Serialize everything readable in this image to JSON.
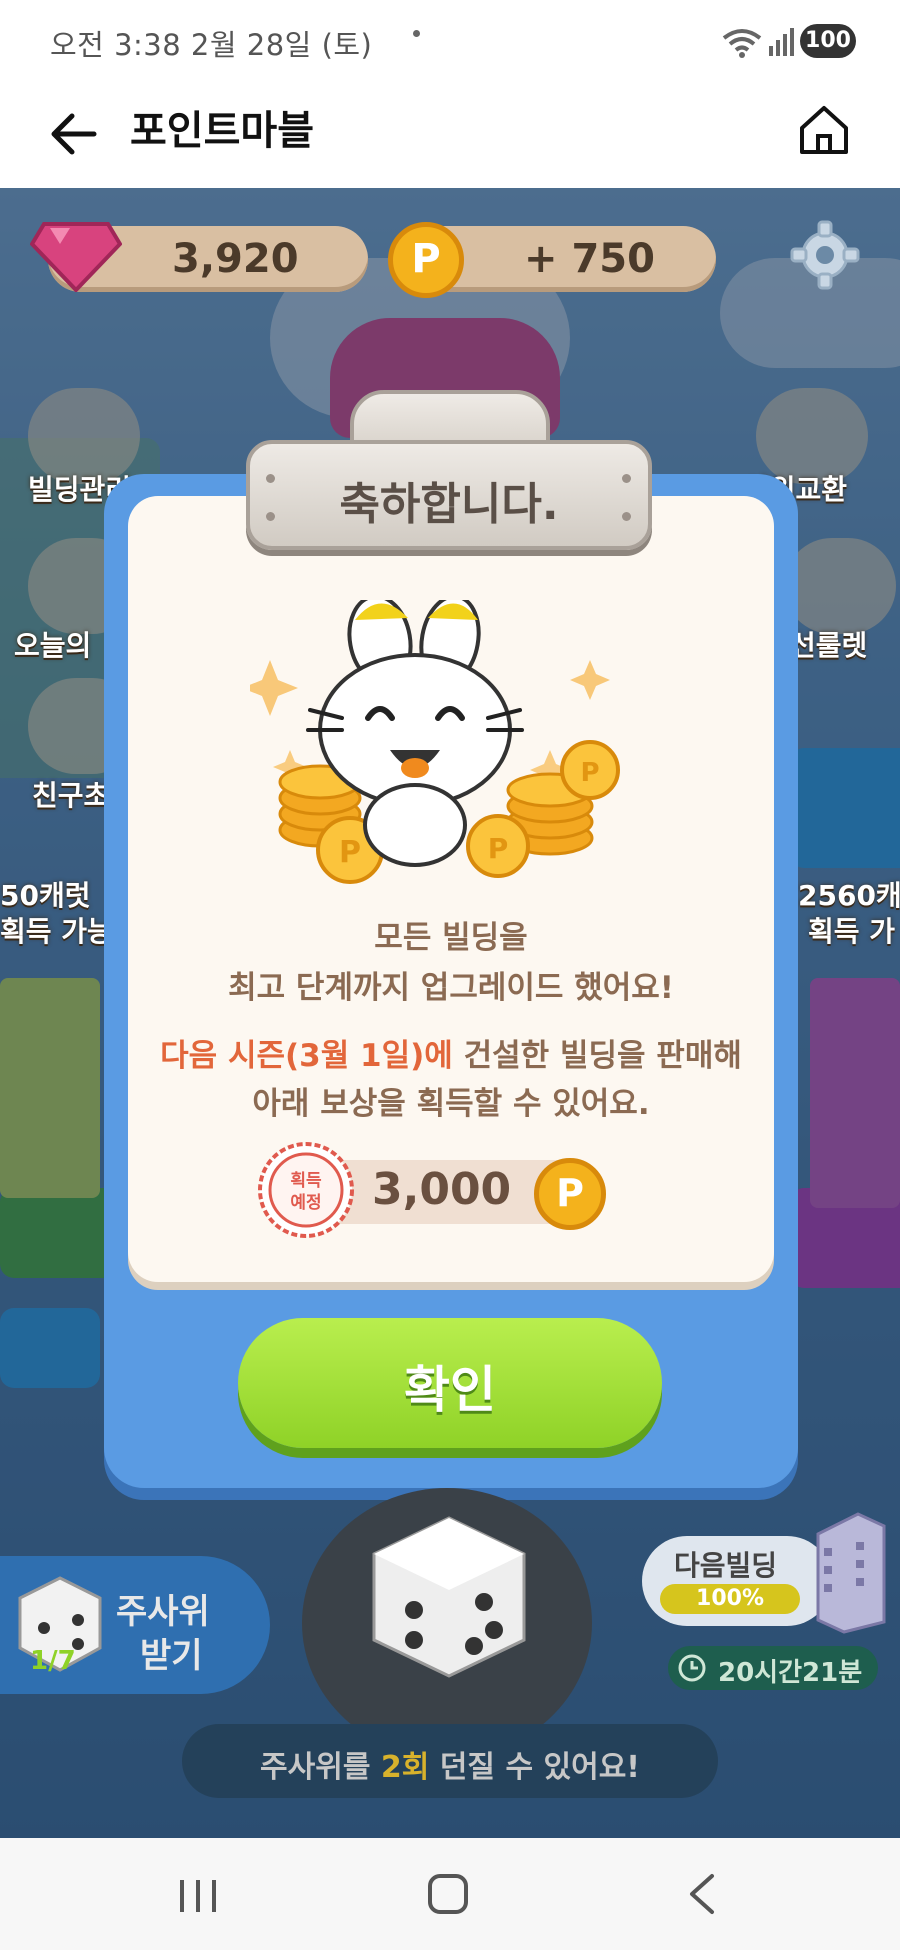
{
  "status_bar": {
    "time": "오전 3:38  2월 28일 (토)",
    "battery": "100"
  },
  "header": {
    "title": "포인트마블",
    "back_icon": "back-arrow-icon",
    "home_icon": "home-icon"
  },
  "game": {
    "gems": "3,920",
    "points_gain": "+ 750",
    "coin_symbol": "P",
    "side_menu": {
      "building_manage": "빌딩관리",
      "dice_exchange": "사위교환",
      "today": "오늘의",
      "roulette": "선룰렛",
      "friend": "친구초",
      "left_reward_line1": "50캐럿",
      "left_reward_line2": "획득 가능",
      "right_reward_line1": "2560캐",
      "right_reward_line2": "획득 가"
    },
    "dice_receive": {
      "count": "1/7",
      "label_line1": "주사위",
      "label_line2": "받기"
    },
    "next_building": {
      "label": "다음빌딩",
      "percent": "100%"
    },
    "timer": "20시간21분",
    "throw_banner": {
      "prefix": "주사위를 ",
      "highlight": "2회",
      "suffix": " 던질 수 있어요!"
    }
  },
  "modal": {
    "title": "축하합니다.",
    "message_line1": "모든 빌딩을",
    "message_line2": "최고 단계까지 업그레이드 했어요!",
    "message_line3_highlight": "다음 시즌(3월 1일)에",
    "message_line3_rest": " 건설한 빌딩을 판매해",
    "message_line4": "아래 보상을 획득할 수 있어요.",
    "stamp_line1": "획득",
    "stamp_line2": "예정",
    "reward_value": "3,000",
    "reward_coin_symbol": "P",
    "confirm_label": "확인"
  },
  "colors": {
    "modal_blue": "#5a9be3",
    "confirm_green": "#8fd227",
    "highlight_orange": "#e2663a",
    "coin_gold": "#f4b21c"
  }
}
